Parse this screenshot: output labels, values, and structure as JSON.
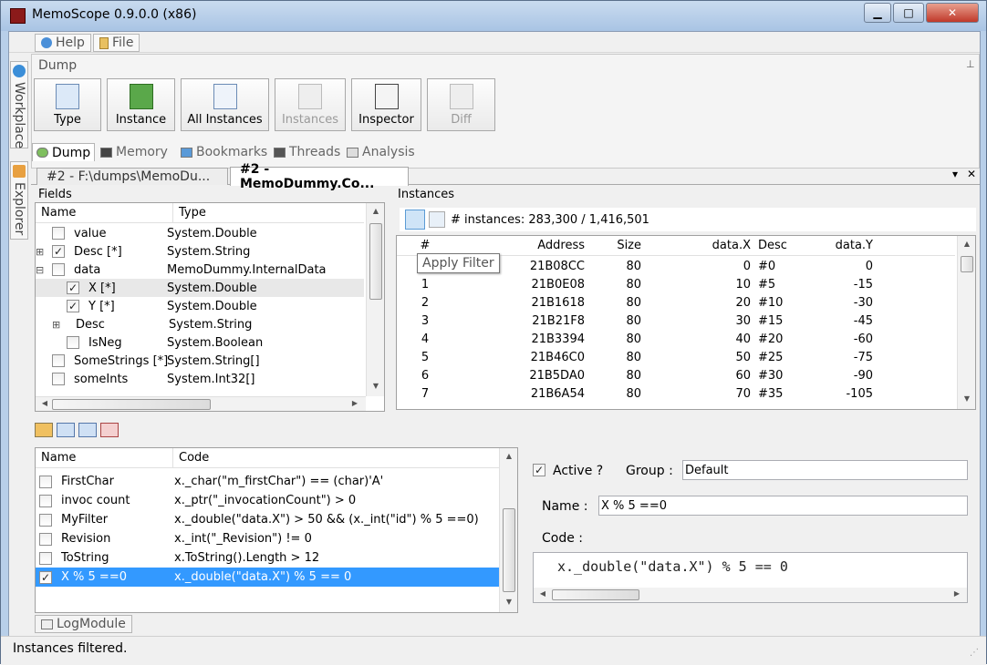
{
  "window": {
    "title": "MemoScope 0.9.0.0 (x86)",
    "min": "▁",
    "max": "□",
    "close": "✕"
  },
  "menu": {
    "help": "Help",
    "file": "File"
  },
  "side_tabs": {
    "workplace": "Workplace",
    "explorer": "Explorer"
  },
  "ribbon": {
    "group": "Dump",
    "pin": "⊥",
    "buttons": [
      {
        "label": "Type"
      },
      {
        "label": "Instance"
      },
      {
        "label": "All Instances"
      },
      {
        "label": "Instances"
      },
      {
        "label": "Inspector"
      },
      {
        "label": "Diff"
      }
    ]
  },
  "section_tabs": [
    "Dump",
    "Memory",
    "Bookmarks",
    "Threads",
    "Analysis"
  ],
  "doc_tabs": {
    "tab1": "#2 - F:\\dumps\\MemoDu...",
    "tab2": "#2 - MemoDummy.Co...",
    "dropdown": "▾",
    "close": "✕"
  },
  "fields": {
    "title": "Fields",
    "col_name": "Name",
    "col_type": "Type",
    "rows": [
      {
        "name": "value",
        "type": "System.Double"
      },
      {
        "name": "Desc [*]",
        "type": "System.String"
      },
      {
        "name": "data",
        "type": "MemoDummy.InternalData"
      },
      {
        "name": "X [*]",
        "type": "System.Double"
      },
      {
        "name": "Y [*]",
        "type": "System.Double"
      },
      {
        "name": "Desc",
        "type": "System.String"
      },
      {
        "name": "IsNeg",
        "type": "System.Boolean"
      },
      {
        "name": "SomeStrings [*]",
        "type": "System.String[]"
      },
      {
        "name": "someInts",
        "type": "System.Int32[]"
      }
    ]
  },
  "instances": {
    "title": "Instances",
    "count": "# instances: 283,300 / 1,416,501",
    "tooltip": "Apply Filter",
    "cols": [
      "#",
      "Address",
      "Size",
      "data.X",
      "Desc",
      "data.Y"
    ],
    "rows": [
      [
        "0",
        "21B08CC",
        "80",
        "0",
        "#0",
        "0"
      ],
      [
        "1",
        "21B0E08",
        "80",
        "10",
        "#5",
        "-15"
      ],
      [
        "2",
        "21B1618",
        "80",
        "20",
        "#10",
        "-30"
      ],
      [
        "3",
        "21B21F8",
        "80",
        "30",
        "#15",
        "-45"
      ],
      [
        "4",
        "21B3394",
        "80",
        "40",
        "#20",
        "-60"
      ],
      [
        "5",
        "21B46C0",
        "80",
        "50",
        "#25",
        "-75"
      ],
      [
        "6",
        "21B5DA0",
        "80",
        "60",
        "#30",
        "-90"
      ],
      [
        "7",
        "21B6A54",
        "80",
        "70",
        "#35",
        "-105"
      ]
    ]
  },
  "filters": {
    "col_name": "Name",
    "col_code": "Code",
    "rows": [
      {
        "name": "FirstChar",
        "code": "x._char(\"m_firstChar\") == (char)'A'",
        "checked": false
      },
      {
        "name": "invoc count",
        "code": "x._ptr(\"_invocationCount\") > 0",
        "checked": false
      },
      {
        "name": "MyFilter",
        "code": "x._double(\"data.X\") > 50 &&  (x._int(\"id\") % 5 ==0)",
        "checked": false
      },
      {
        "name": "Revision",
        "code": "x._int(\"_Revision\") != 0",
        "checked": false
      },
      {
        "name": "ToString",
        "code": "x.ToString().Length > 12",
        "checked": false
      },
      {
        "name": "X % 5 ==0",
        "code": "x._double(\"data.X\") % 5 == 0",
        "checked": true
      }
    ]
  },
  "editor": {
    "active_label": "Active ?",
    "group_label": "Group :",
    "group_value": "Default",
    "name_label": "Name :",
    "name_value": "X % 5 ==0",
    "code_label": "Code :",
    "code_value": "x._double(\"data.X\") % 5 == 0"
  },
  "log_tab": "LogModule",
  "status": "Instances filtered.",
  "colors": {
    "selection": "#3399ff",
    "accent": "#3b8ed8"
  }
}
